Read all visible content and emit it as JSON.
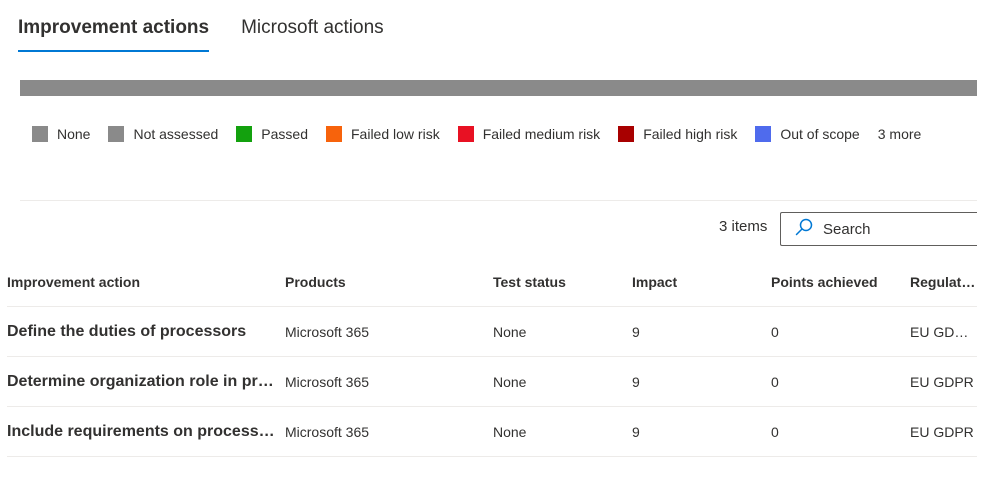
{
  "tabs": [
    {
      "label": "Improvement actions",
      "active": true
    },
    {
      "label": "Microsoft actions",
      "active": false
    }
  ],
  "legend": {
    "items": [
      {
        "label": "None",
        "color": "#8a8a8a"
      },
      {
        "label": "Not assessed",
        "color": "#8a8a8a"
      },
      {
        "label": "Passed",
        "color": "#13a10e"
      },
      {
        "label": "Failed low risk",
        "color": "#f7630c"
      },
      {
        "label": "Failed medium risk",
        "color": "#e81123"
      },
      {
        "label": "Failed high risk",
        "color": "#a80000"
      },
      {
        "label": "Out of scope",
        "color": "#4f6bed"
      }
    ],
    "more_label": "3 more"
  },
  "toolbar": {
    "items_count": "3 items",
    "search_placeholder": "Search"
  },
  "table": {
    "headers": [
      "Improvement action",
      "Products",
      "Test status",
      "Impact",
      "Points achieved",
      "Regulation"
    ],
    "rows": [
      [
        "Define the duties of processors",
        "Microsoft 365",
        "None",
        "9",
        "0",
        "EU GDPRDa"
      ],
      [
        "Determine organization role in pro...",
        "Microsoft 365",
        "None",
        "9",
        "0",
        "EU GDPR"
      ],
      [
        "Include requirements on processin...",
        "Microsoft 365",
        "None",
        "9",
        "0",
        "EU GDPR"
      ]
    ]
  },
  "colors": {
    "accent": "#0078d4",
    "progress_fill": "#8a8a8a"
  }
}
